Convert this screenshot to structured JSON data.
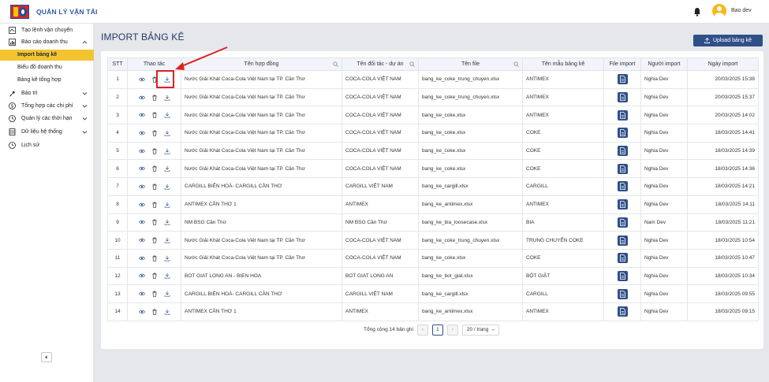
{
  "app": {
    "title": "QUẢN LÝ VẬN TẢI",
    "user": "Bao dev"
  },
  "sidebar": {
    "items": [
      {
        "label": "Tạo lệnh vận chuyển",
        "icon": "truck-icon"
      },
      {
        "label": "Báo cáo doanh thu",
        "icon": "chart-icon",
        "expanded": true
      },
      {
        "label": "Bảo trì",
        "icon": "wrench-icon"
      },
      {
        "label": "Tổng hợp các chi phí",
        "icon": "dollar-icon"
      },
      {
        "label": "Quản lý các thời hạn",
        "icon": "clock-icon"
      },
      {
        "label": "Dữ liệu hệ thống",
        "icon": "database-icon"
      },
      {
        "label": "Lịch sử",
        "icon": "history-icon"
      }
    ],
    "sub_items": [
      {
        "label": "Import bảng kê",
        "active": true
      },
      {
        "label": "Biểu đồ doanh thu",
        "active": false
      },
      {
        "label": "Bảng kê tổng hợp",
        "active": false
      }
    ]
  },
  "page": {
    "title": "IMPORT BẢNG KÊ",
    "upload_label": "Upload bảng kê"
  },
  "table": {
    "headers": [
      "STT",
      "Thao tác",
      "Tên hợp đồng",
      "Tên đối tác - dự án",
      "Tên file",
      "Tên mẫu bảng kê",
      "File import",
      "Người import",
      "Ngày import"
    ],
    "rows": [
      {
        "stt": "1",
        "contract": "Nước Giải Khát Coca-Cola Việt Nam tại TP. Cần Thơ",
        "partner": "COCA-COLA VIỆT NAM",
        "file": "bang_ke_coke_trung_chuyen.xlsx",
        "template": "ANTIMEX",
        "user": "Nghia Dev",
        "date": "20/03/2025 15:38"
      },
      {
        "stt": "2",
        "contract": "Nước Giải Khát Coca-Cola Việt Nam tại TP. Cần Thơ",
        "partner": "COCA-COLA VIỆT NAM",
        "file": "bang_ke_coke_trung_chuyen.xlsx",
        "template": "ANTIMEX",
        "user": "Nghia Dev",
        "date": "20/03/2025 15:37"
      },
      {
        "stt": "3",
        "contract": "Nước Giải Khát Coca-Cola Việt Nam tại TP. Cần Thơ",
        "partner": "COCA-COLA VIỆT NAM",
        "file": "bang_ke_coke.xlsx",
        "template": "ANTIMEX",
        "user": "Nghia Dev",
        "date": "20/03/2025 14:02"
      },
      {
        "stt": "4",
        "contract": "Nước Giải Khát Coca-Cola Việt Nam tại TP. Cần Thơ",
        "partner": "COCA-COLA VIỆT NAM",
        "file": "bang_ke_coke.xlsx",
        "template": "COKE",
        "user": "Nghia Dev",
        "date": "18/03/2025 14:41"
      },
      {
        "stt": "5",
        "contract": "Nước Giải Khát Coca-Cola Việt Nam tại TP. Cần Thơ",
        "partner": "COCA-COLA VIỆT NAM",
        "file": "bang_ke_coke.xlsx",
        "template": "COKE",
        "user": "Nghia Dev",
        "date": "18/03/2025 14:39"
      },
      {
        "stt": "6",
        "contract": "Nước Giải Khát Coca-Cola Việt Nam tại TP. Cần Thơ",
        "partner": "COCA-COLA VIỆT NAM",
        "file": "bang_ke_coke.xlsx",
        "template": "COKE",
        "user": "Nghia Dev",
        "date": "18/03/2025 14:36"
      },
      {
        "stt": "7",
        "contract": "CARGILL BIÊN HOÀ- CARGILL CẦN THƠ",
        "partner": "CARGILL VIỆT NAM",
        "file": "bang_ke_cargill.xlsx",
        "template": "CARGILL",
        "user": "Nghia Dev",
        "date": "18/03/2025 14:21"
      },
      {
        "stt": "8",
        "contract": "ANTIMEX CẦN THƠ 1",
        "partner": "ANTIMEX",
        "file": "bang_ke_antimex.xlsx",
        "template": "ANTIMEX",
        "user": "Nghia Dev",
        "date": "18/03/2025 14:11"
      },
      {
        "stt": "9",
        "contract": "NM BSG Cần Thơ",
        "partner": "NM BSG Cần Thơ",
        "file": "bang_ke_bia_loosecase.xlsx",
        "template": "BIA",
        "user": "Nam Dev",
        "date": "18/03/2025 11:21"
      },
      {
        "stt": "10",
        "contract": "Nước Giải Khát Coca-Cola Việt Nam tại TP. Cần Thơ",
        "partner": "COCA-COLA VIỆT NAM",
        "file": "bang_ke_coke_trung_chuyen.xlsx",
        "template": "TRUNG CHUYỂN COKE",
        "user": "Nghia Dev",
        "date": "18/03/2025 10:54"
      },
      {
        "stt": "11",
        "contract": "Nước Giải Khát Coca-Cola Việt Nam tại TP. Cần Thơ",
        "partner": "COCA-COLA VIỆT NAM",
        "file": "bang_ke_coke.xlsx",
        "template": "COKE",
        "user": "Nghia Dev",
        "date": "18/03/2025 10:47"
      },
      {
        "stt": "12",
        "contract": "BOT GIAT LONG AN - BIEN HOA",
        "partner": "BOT GIAT LONG AN",
        "file": "bang_ke_bot_giat.xlsx",
        "template": "BỘT GIẶT",
        "user": "Nghia Dev",
        "date": "18/03/2025 10:34"
      },
      {
        "stt": "13",
        "contract": "CARGILL BIÊN HOÀ- CARGILL CẦN THƠ",
        "partner": "CARGILL VIỆT NAM",
        "file": "bang_ke_cargill.xlsx",
        "template": "CARGILL",
        "user": "Nghia Dev",
        "date": "18/03/2025 09:55"
      },
      {
        "stt": "14",
        "contract": "ANTIMEX CẦN THƠ 1",
        "partner": "ANTIMEX",
        "file": "bang_ke_antimex.xlsx",
        "template": "ANTIMEX",
        "user": "Nghia Dev",
        "date": "18/03/2025 09:15"
      }
    ]
  },
  "pagination": {
    "total_label": "Tổng cộng 14 bản ghi",
    "current_page": "1",
    "page_size": "20 / trang"
  },
  "colors": {
    "accent": "#2f4f88",
    "active_menu": "#f4c430",
    "annotation": "#e02020"
  }
}
